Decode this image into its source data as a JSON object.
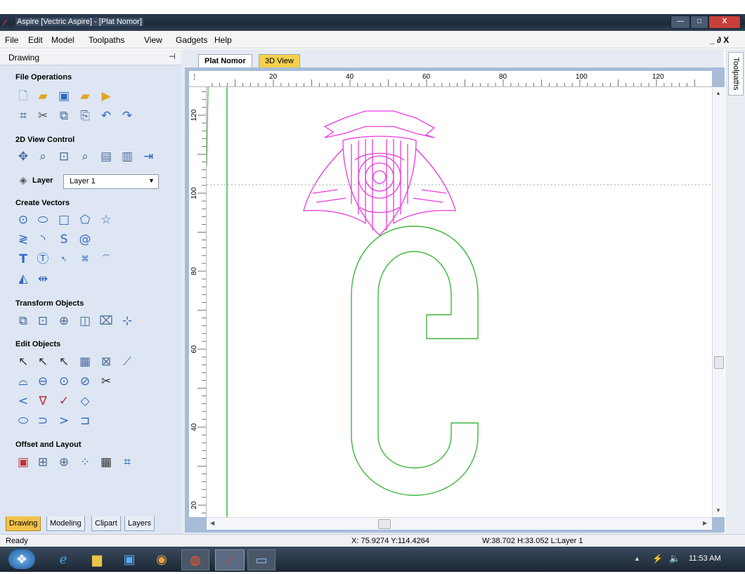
{
  "window": {
    "title": "Aspire [Vectric Aspire] - [Plat Nomor]",
    "buttons": {
      "minimize": "—",
      "maximize": "□",
      "close": "X"
    }
  },
  "menu": {
    "items": [
      "File",
      "Edit",
      "Model",
      "Toolpaths",
      "View",
      "Gadgets",
      "Help"
    ],
    "mdi_controls": "_ ∂ X"
  },
  "panel": {
    "title": "Drawing",
    "pin": "⊣",
    "sections": {
      "file_operations": "File Operations",
      "view_control": "2D View Control",
      "create_vectors": "Create Vectors",
      "transform_objects": "Transform Objects",
      "edit_objects": "Edit Objects",
      "offset_layout": "Offset and Layout"
    },
    "layer_label": "Layer",
    "layer_value": "Layer 1",
    "bottom_tabs": [
      "Drawing",
      "Modeling",
      "Clipart",
      "Layers"
    ]
  },
  "icons": {
    "file_ops": [
      "new-file-icon",
      "open-file-icon",
      "save-file-icon",
      "import-icon",
      "export-icon",
      "select-all-icon",
      "cut-icon",
      "copy-icon",
      "paste-icon",
      "undo-icon",
      "redo-icon"
    ],
    "view_ops": [
      "pan-icon",
      "zoom-icon",
      "zoom-box-icon",
      "zoom-fit-icon",
      "view-box-icon",
      "view-split-icon",
      "view-next-icon"
    ],
    "create_vectors": [
      "circle-icon",
      "ellipse-icon",
      "rectangle-icon",
      "polygon-icon",
      "star-icon",
      "polyline-icon",
      "arc-icon",
      "curve-icon",
      "spiral-icon",
      "text-icon",
      "text-box-icon",
      "text-path-icon",
      "text-shape-icon",
      "text-arc-icon",
      "node-icon",
      "dimension-icon"
    ],
    "transform": [
      "move-icon",
      "scale-icon",
      "rotate-icon",
      "mirror-icon",
      "distort-icon",
      "align-icon"
    ],
    "edit": [
      "select-icon",
      "node-edit-icon",
      "transform-edit-icon",
      "group-icon",
      "ungroup-icon",
      "measure-icon",
      "weld-icon",
      "subtract-icon",
      "intersect-icon",
      "trim-icon",
      "scissors-icon",
      "fillet-icon",
      "chamfer-icon",
      "extend-icon",
      "smooth-icon",
      "join-icon",
      "bracket-icon",
      "arrow-right-icon",
      "bracket-right-icon"
    ],
    "offset": [
      "offset-icon",
      "array-icon",
      "circular-array-icon",
      "nest-icon",
      "grid-icon",
      "tile-icon"
    ]
  },
  "document": {
    "tabs": [
      "Plat Nomor",
      "3D View"
    ],
    "ruler_x_labels": [
      "20",
      "40",
      "60",
      "80",
      "100",
      "120"
    ],
    "ruler_y_labels": [
      "120",
      "100",
      "80",
      "60",
      "40",
      "20"
    ]
  },
  "right_panel": {
    "label": "Toolpaths"
  },
  "status": {
    "message": "Ready",
    "coords": "X: 75.9274 Y:114.4264",
    "dims": "W:38.702  H:33.052  L:Layer 1"
  },
  "taskbar": {
    "apps": [
      "start-orb-icon",
      "ie-icon",
      "explorer-icon",
      "media-icon",
      "chrome-icon",
      "app-icon",
      "aspire-icon",
      "window-icon"
    ],
    "tray_icons": [
      "tray-up-icon",
      "network-icon",
      "volume-icon"
    ],
    "clock": "11:53 AM"
  },
  "colors": {
    "accent": "#2a6fbf",
    "vector_green": "#3cb83c",
    "badge_magenta": "#e83cdc",
    "panel_bg": "#dde6f2"
  }
}
